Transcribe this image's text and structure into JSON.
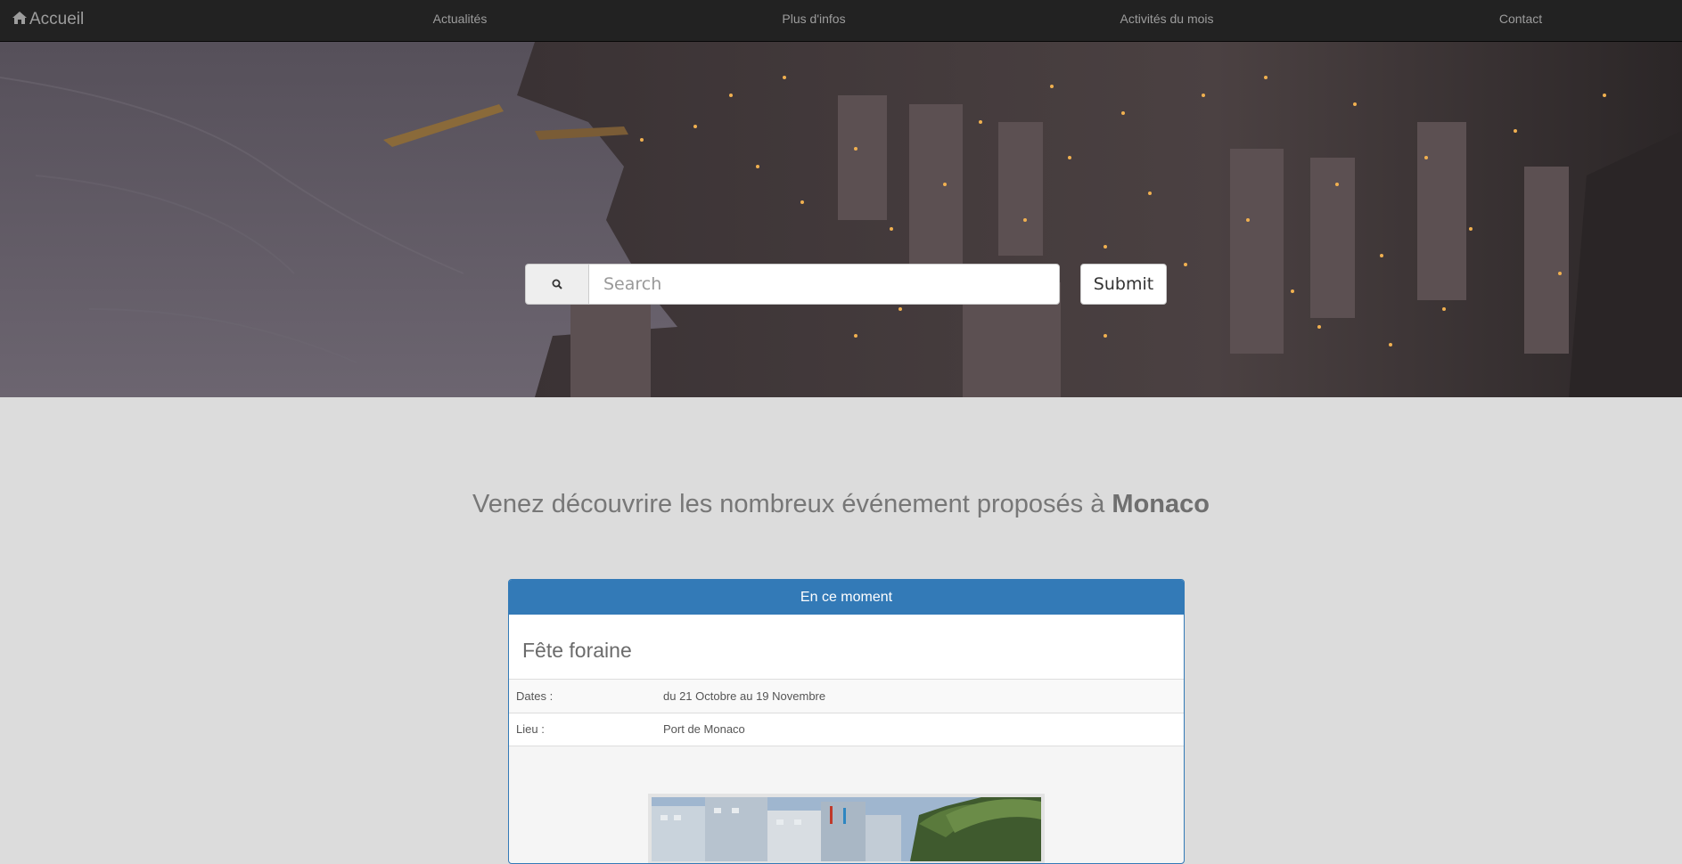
{
  "navbar": {
    "brand_label": "Accueil",
    "links": [
      {
        "label": "Actualités"
      },
      {
        "label": "Plus d'infos"
      },
      {
        "label": "Activités du mois"
      },
      {
        "label": "Contact"
      }
    ]
  },
  "search": {
    "placeholder": "Search",
    "value": "",
    "icon": "search-icon",
    "submit_label": "Submit"
  },
  "intro": {
    "text": "Venez découvrire les nombreux événement proposés à ",
    "highlight": "Monaco"
  },
  "event_panel": {
    "heading": "En ce moment",
    "title": "Fête foraine",
    "rows": [
      {
        "label": "Dates :",
        "value": "du 21 Octobre au 19 Novembre"
      },
      {
        "label": "Lieu :",
        "value": "Port de Monaco"
      }
    ]
  },
  "colors": {
    "navbar_bg": "#222222",
    "primary": "#337ab7",
    "page_bg": "#dcdcdc"
  }
}
